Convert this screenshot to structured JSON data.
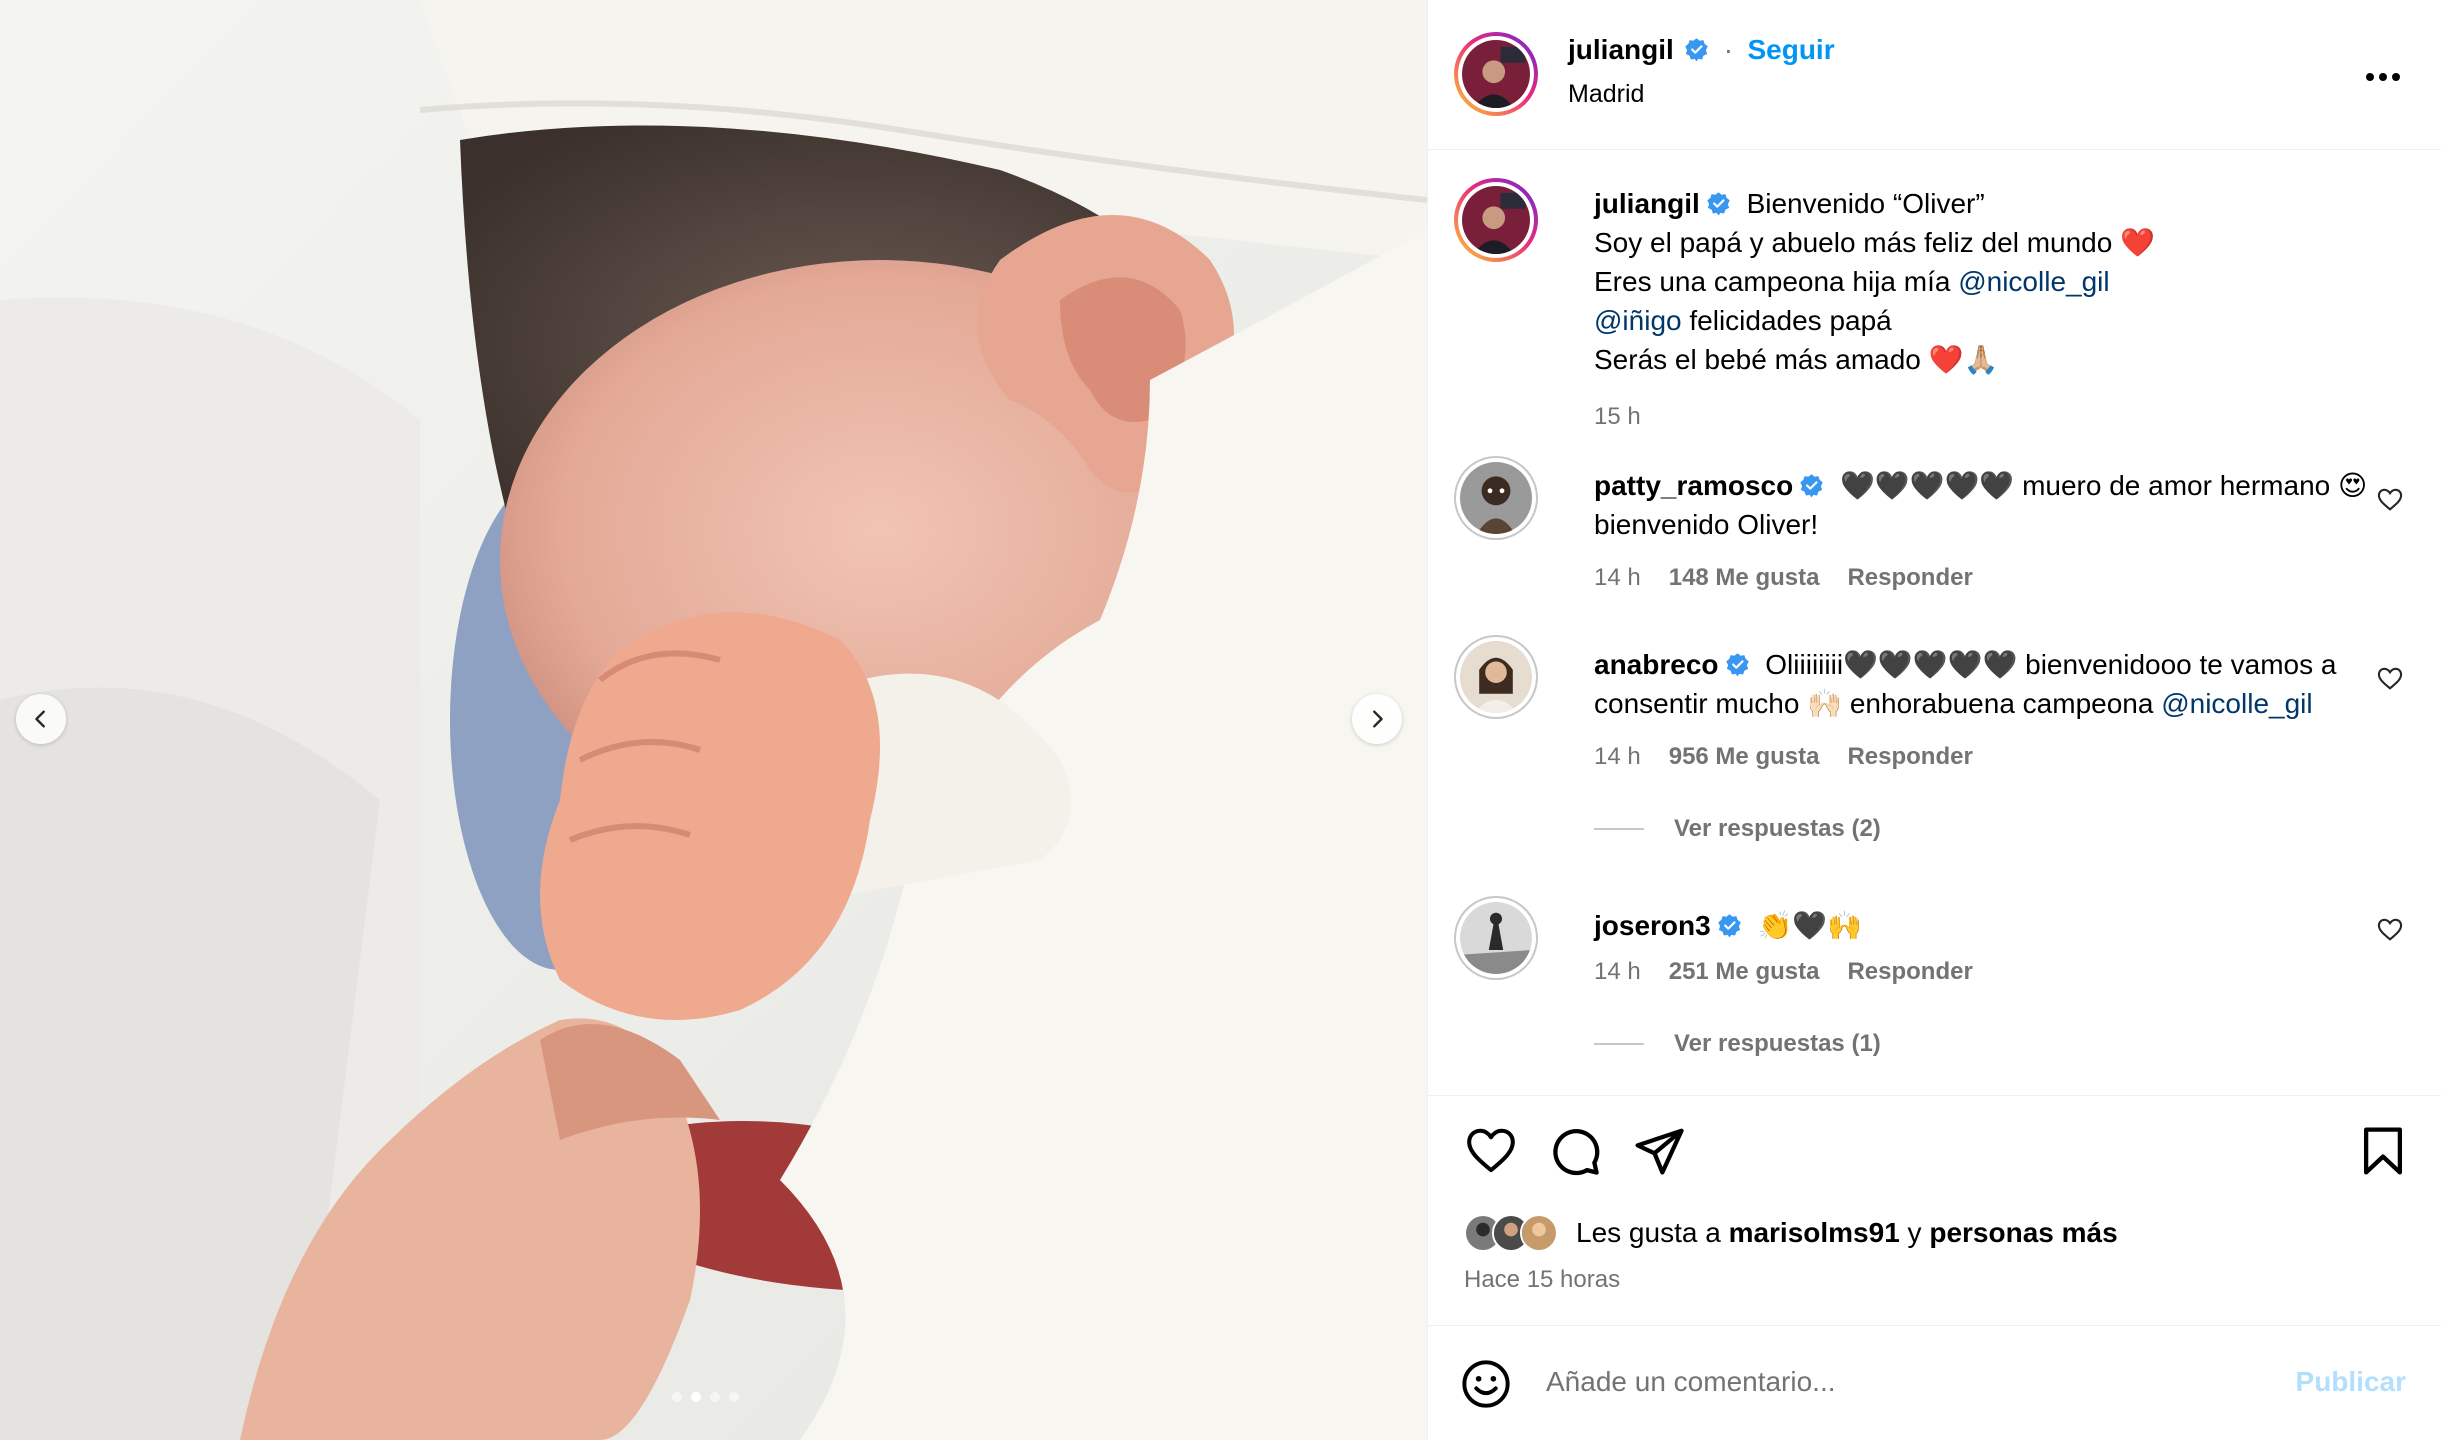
{
  "post": {
    "username": "juliangil",
    "follow_label": "Seguir",
    "separator": "·",
    "location": "Madrid",
    "more_icon": "more-options-icon"
  },
  "caption": {
    "username": "juliangil",
    "line1": "Bienvenido “Oliver”",
    "line2": "Soy el papá y abuelo más feliz del mundo ❤️",
    "line3_text": "Eres una campeona hija mía ",
    "line3_mention": "@nicolle_gil",
    "line4_mention": "@iñigo",
    "line4_text": " felicidades papá",
    "line5": "Serás el bebé más amado ❤️🙏🏼",
    "time": "15 h"
  },
  "comments": [
    {
      "username": "patty_ramosco",
      "text": "🖤🖤🖤🖤🖤 muero de amor hermano 😍 bienvenido Oliver!",
      "mention": "",
      "time": "14 h",
      "likes": "148 Me gusta",
      "reply": "Responder"
    },
    {
      "username": "anabreco",
      "text": "Oliiiiiiii🖤🖤🖤🖤🖤 bienvenidooo te vamos a consentir mucho 🙌🏻 enhorabuena campeona ",
      "mention": "@nicolle_gil",
      "time": "14 h",
      "likes": "956 Me gusta",
      "reply": "Responder",
      "view_replies": "Ver respuestas (2)"
    },
    {
      "username": "joseron3",
      "text": "👏🖤🙌",
      "mention": "",
      "time": "14 h",
      "likes": "251 Me gusta",
      "reply": "Responder",
      "view_replies": "Ver respuestas (1)"
    }
  ],
  "likes": {
    "prefix": "Les gusta a ",
    "user": "marisolms91",
    "middle": " y ",
    "others": "personas más",
    "when": "Hace 15 horas"
  },
  "composer": {
    "placeholder": "Añade un comentario...",
    "publish_label": "Publicar"
  },
  "carousel": {
    "count": 4,
    "active_index": 1
  },
  "colors": {
    "accent": "#0095f6",
    "mention": "#00376b",
    "muted": "#737373",
    "verified": "#3897f0"
  }
}
